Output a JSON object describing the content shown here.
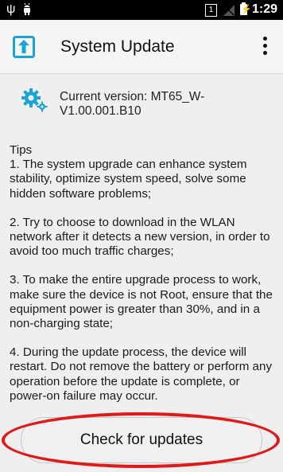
{
  "status_bar": {
    "usb_icon": "usb-icon",
    "android_icon": "android-debug-icon",
    "sim_slot": "1",
    "signal_icon": "no-signal-icon",
    "battery_icon": "battery-charging-icon",
    "time": "1:29"
  },
  "action_bar": {
    "icon": "system-update-icon",
    "title": "System Update",
    "overflow_icon": "more-vert-icon",
    "accent_color": "#1ba3d4"
  },
  "version": {
    "icon": "gear-icon",
    "text": "Current version: MT65_W-V1.00.001.B10"
  },
  "tips": {
    "title": "Tips",
    "items": [
      "1. The system upgrade can enhance system stability, optimize system speed, solve some hidden software problems;",
      "2. Try to choose to download in the WLAN network after it detects a new version, in order to avoid too much traffic charges;",
      "3. To make the entire upgrade process to work, make sure the device is not Root, ensure that the equipment power is greater than 30%, and in a non-charging state;",
      "4. During the update process, the device will restart. Do not remove the battery or perform any operation before the update is complete, or power-on failure may occur."
    ]
  },
  "actions": {
    "check_label": "Check for updates",
    "highlight_color": "#e01919"
  }
}
